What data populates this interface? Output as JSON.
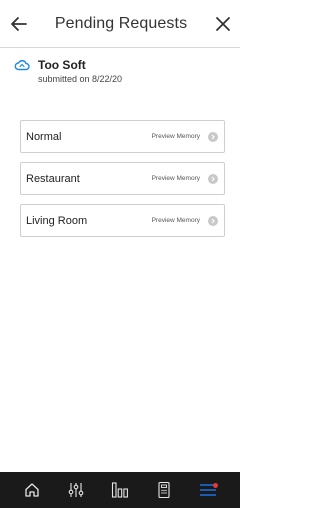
{
  "header": {
    "title": "Pending Requests"
  },
  "request": {
    "name": "Too Soft",
    "submitted": "submitted on 8/22/20",
    "icon": "cloud-icon"
  },
  "memories": [
    {
      "label": "Normal",
      "action": "Preview Memory"
    },
    {
      "label": "Restaurant",
      "action": "Preview Memory"
    },
    {
      "label": "Living Room",
      "action": "Preview Memory"
    }
  ],
  "tabbar": {
    "items": [
      "home-icon",
      "sliders-icon",
      "bars-icon",
      "remote-icon",
      "menu-icon"
    ],
    "active": "menu-icon",
    "accent": "#1a73e8",
    "badge_color": "#e53935"
  },
  "colors": {
    "cloud": "#1e88e5",
    "tabbar_bg": "#1a1a1a"
  }
}
